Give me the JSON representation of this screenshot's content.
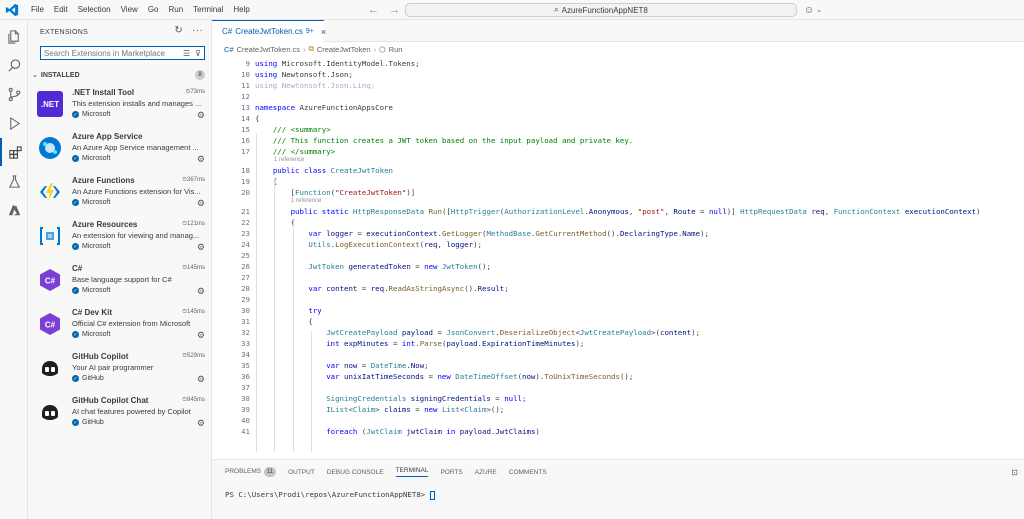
{
  "window": {
    "menu": [
      "File",
      "Edit",
      "Selection",
      "View",
      "Go",
      "Run",
      "Terminal",
      "Help"
    ],
    "search_title": "AzureFunctionAppNET8"
  },
  "sidebar": {
    "title": "EXTENSIONS",
    "search_placeholder": "Search Extensions in Marketplace",
    "section": "INSTALLED",
    "installed_count": "8",
    "extensions": [
      {
        "name": ".NET Install Tool",
        "desc": "This extension installs and manages ...",
        "publisher": "Microsoft",
        "time": "73ms",
        "icon_text": ".NET",
        "icon_color": "#512bd4"
      },
      {
        "name": "Azure App Service",
        "desc": "An Azure App Service management ...",
        "publisher": "Microsoft",
        "time": "",
        "icon_text": "",
        "icon_color": "#0078d4"
      },
      {
        "name": "Azure Functions",
        "desc": "An Azure Functions extension for Vis...",
        "publisher": "Microsoft",
        "time": "367ms",
        "icon_text": "⚡",
        "icon_color": "#ffffff"
      },
      {
        "name": "Azure Resources",
        "desc": "An extension for viewing and manag...",
        "publisher": "Microsoft",
        "time": "121ms",
        "icon_text": "[ ]",
        "icon_color": "#ffffff"
      },
      {
        "name": "C#",
        "desc": "Base language support for C#",
        "publisher": "Microsoft",
        "time": "145ms",
        "icon_text": "C#",
        "icon_color": "#7b3fd6"
      },
      {
        "name": "C# Dev Kit",
        "desc": "Official C# extension from Microsoft",
        "publisher": "Microsoft",
        "time": "145ms",
        "icon_text": "C#",
        "icon_color": "#7b3fd6"
      },
      {
        "name": "GitHub Copilot",
        "desc": "Your AI pair programmer",
        "publisher": "GitHub",
        "time": "529ms",
        "icon_text": "",
        "icon_color": "#ffffff"
      },
      {
        "name": "GitHub Copilot Chat",
        "desc": "AI chat features powered by Copilot",
        "publisher": "GitHub",
        "time": "845ms",
        "icon_text": "",
        "icon_color": "#ffffff"
      }
    ]
  },
  "editor": {
    "tab": {
      "label": "CreateJwtToken.cs",
      "badge": "9+"
    },
    "breadcrumb": [
      "CreateJwtToken.cs",
      "CreateJwtToken",
      "Run"
    ],
    "lines": [
      {
        "n": "9",
        "html": "<span class=\"k\">using</span> Microsoft.IdentityModel.Tokens;"
      },
      {
        "n": "10",
        "html": "<span class=\"k\">using</span> Newtonsoft.Json;"
      },
      {
        "n": "11",
        "html": "<span class=\"dim\">using Newtonsoft.Json.Linq;</span>"
      },
      {
        "n": "12",
        "html": ""
      },
      {
        "n": "13",
        "html": "<span class=\"k\">namespace</span> AzureFunctionAppsCore"
      },
      {
        "n": "14",
        "html": "{"
      },
      {
        "n": "15",
        "html": "    <span class=\"c\">/// &lt;summary&gt;</span>"
      },
      {
        "n": "16",
        "html": "    <span class=\"c\">/// This function creates a JWT token based on the input payload and private key.</span>"
      },
      {
        "n": "17",
        "html": "    <span class=\"c\">/// &lt;/summary&gt;</span>"
      },
      {
        "n": "18",
        "html": "    <span class=\"k\">public class</span> <span class=\"t\">CreateJwtToken</span>"
      },
      {
        "n": "19",
        "html": "    {"
      },
      {
        "n": "20",
        "html": "        [<span class=\"t\">Function</span>(<span class=\"s\">\"CreateJwtToken\"</span>)]"
      },
      {
        "n": "21",
        "html": "        <span class=\"k\">public static</span> <span class=\"t\">HttpResponseData</span> <span class=\"f\">Run</span>([<span class=\"t\">HttpTrigger</span>(<span class=\"t\">AuthorizationLevel</span>.<span class=\"v\">Anonymous</span>, <span class=\"s\">\"post\"</span>, <span class=\"v\">Route</span> = <span class=\"k\">null</span>)] <span class=\"t\">HttpRequestData</span> <span class=\"v\">req</span>, <span class=\"t\">FunctionContext</span> <span class=\"v\">executionContext</span>)"
      },
      {
        "n": "22",
        "html": "        {"
      },
      {
        "n": "23",
        "html": "            <span class=\"k\">var</span> <span class=\"v\">logger</span> = <span class=\"v\">executionContext</span>.<span class=\"f\">GetLogger</span>(<span class=\"t\">MethodBase</span>.<span class=\"f\">GetCurrentMethod</span>().<span class=\"v\">DeclaringType</span>.<span class=\"v\">Name</span>);"
      },
      {
        "n": "24",
        "html": "            <span class=\"t\">Utils</span>.<span class=\"f\">LogExecutionContext</span>(<span class=\"v\">req</span>, <span class=\"v\">logger</span>);"
      },
      {
        "n": "25",
        "html": ""
      },
      {
        "n": "26",
        "html": "            <span class=\"t\">JwtToken</span> <span class=\"v\">generatedToken</span> = <span class=\"k\">new</span> <span class=\"t\">JwtToken</span>();"
      },
      {
        "n": "27",
        "html": ""
      },
      {
        "n": "28",
        "html": "            <span class=\"k\">var</span> <span class=\"v\">content</span> = <span class=\"v\">req</span>.<span class=\"f\">ReadAsStringAsync</span>().<span class=\"v\">Result</span>;"
      },
      {
        "n": "29",
        "html": ""
      },
      {
        "n": "30",
        "html": "            <span class=\"k\">try</span>"
      },
      {
        "n": "31",
        "html": "            {"
      },
      {
        "n": "32",
        "html": "                <span class=\"t\">JwtCreatePayload</span> <span class=\"v\">payload</span> = <span class=\"t\">JsonConvert</span>.<span class=\"f\">DeserializeObject</span>&lt;<span class=\"t\">JwtCreatePayload</span>&gt;(<span class=\"v\">content</span>);"
      },
      {
        "n": "33",
        "html": "                <span class=\"k\">int</span> <span class=\"v\">expMinutes</span> = <span class=\"k\">int</span>.<span class=\"f\">Parse</span>(<span class=\"v\">payload</span>.<span class=\"v\">ExpirationTimeMinutes</span>);"
      },
      {
        "n": "34",
        "html": ""
      },
      {
        "n": "35",
        "html": "                <span class=\"k\">var</span> <span class=\"v\">now</span> = <span class=\"t\">DateTime</span>.<span class=\"v\">Now</span>;"
      },
      {
        "n": "36",
        "html": "                <span class=\"k\">var</span> <span class=\"v\">unixIatTimeSeconds</span> = <span class=\"k\">new</span> <span class=\"t\">DateTimeOffset</span>(<span class=\"v\">now</span>).<span class=\"f\">ToUnixTimeSeconds</span>();"
      },
      {
        "n": "37",
        "html": ""
      },
      {
        "n": "38",
        "html": "                <span class=\"t\">SigningCredentials</span> <span class=\"v\">signingCredentials</span> = <span class=\"k\">null</span>;"
      },
      {
        "n": "39",
        "html": "                <span class=\"t\">IList</span>&lt;<span class=\"t\">Claim</span>&gt; <span class=\"v\">claims</span> = <span class=\"k\">new</span> <span class=\"t\">List</span>&lt;<span class=\"t\">Claim</span>&gt;();"
      },
      {
        "n": "40",
        "html": ""
      },
      {
        "n": "41",
        "html": "                <span class=\"k\">foreach</span> (<span class=\"t\">JwtClaim</span> <span class=\"v\">jwtClaim</span> <span class=\"k\">in</span> <span class=\"v\">payload</span>.<span class=\"v\">JwtClaims</span>)"
      }
    ],
    "codelens": [
      {
        "after": "17",
        "text": "1 reference"
      },
      {
        "after": "20",
        "text": "1 reference"
      }
    ]
  },
  "panel": {
    "tabs": [
      "PROBLEMS",
      "OUTPUT",
      "DEBUG CONSOLE",
      "TERMINAL",
      "PORTS",
      "AZURE",
      "COMMENTS"
    ],
    "problems_count": "11",
    "active_tab": "TERMINAL",
    "prompt": "PS C:\\Users\\Prodi\\repos\\AzureFunctionAppNET8> "
  }
}
